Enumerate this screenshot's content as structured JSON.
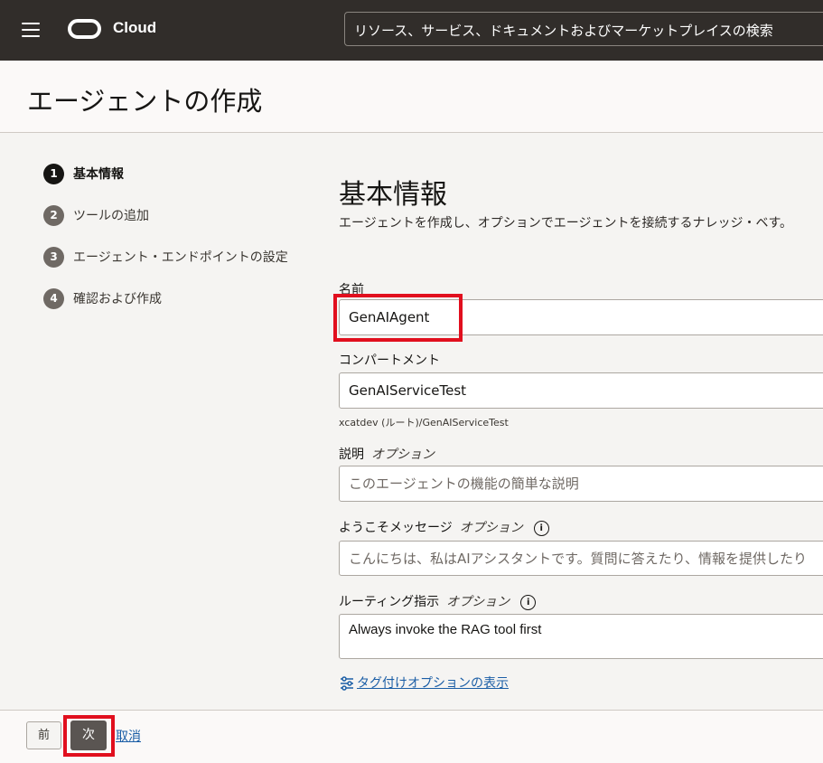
{
  "topbar": {
    "brand": "Cloud",
    "search_placeholder": "リソース、サービス、ドキュメントおよびマーケットプレイスの検索"
  },
  "header": {
    "title": "エージェントの作成"
  },
  "steps": [
    {
      "num": "1",
      "label": "基本情報",
      "active": true
    },
    {
      "num": "2",
      "label": "ツールの追加",
      "active": false
    },
    {
      "num": "3",
      "label": "エージェント・エンドポイントの設定",
      "active": false
    },
    {
      "num": "4",
      "label": "確認および作成",
      "active": false
    }
  ],
  "form": {
    "section_title": "基本情報",
    "section_desc": "エージェントを作成し、オプションでエージェントを接続するナレッジ・ベす。",
    "name": {
      "label": "名前",
      "value": "GenAIAgent"
    },
    "compartment": {
      "label": "コンパートメント",
      "value": "GenAIServiceTest",
      "path": "xcatdev (ルート)/GenAIServiceTest"
    },
    "description": {
      "label": "説明",
      "optional": "オプション",
      "placeholder": "このエージェントの機能の簡単な説明"
    },
    "welcome": {
      "label": "ようこそメッセージ",
      "optional": "オプション",
      "placeholder": "こんにちは、私はAIアシスタントです。質問に答えたり、情報を提供したり"
    },
    "routing": {
      "label": "ルーティング指示",
      "optional": "オプション",
      "value": "Always invoke the RAG tool first"
    },
    "tag_link": "タグ付けオプションの表示"
  },
  "footer": {
    "prev": "前",
    "next": "次",
    "cancel": "取消"
  },
  "colors": {
    "topbar": "#312d2a",
    "highlight": "#e10f1e",
    "link": "#1b5ea6"
  }
}
